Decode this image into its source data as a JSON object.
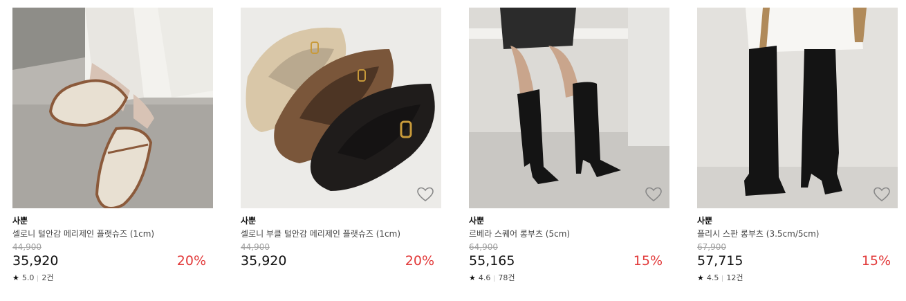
{
  "products": [
    {
      "brand": "사뿐",
      "title": "셀로니 털안감 메리제인 플랫슈즈 (1cm)",
      "original_price": "44,900",
      "price": "35,920",
      "discount": "20%",
      "rating": "5.0",
      "reviews": "2건"
    },
    {
      "brand": "사뿐",
      "title": "셀로니 부클 털안감 메리제인 플랫슈즈 (1cm)",
      "original_price": "44,900",
      "price": "35,920",
      "discount": "20%"
    },
    {
      "brand": "사뿐",
      "title": "르베라 스퀘어 롱부츠 (5cm)",
      "original_price": "64,900",
      "price": "55,165",
      "discount": "15%",
      "rating": "4.6",
      "reviews": "78건"
    },
    {
      "brand": "사뿐",
      "title": "플리시 스판 롱부츠 (3.5cm/5cm)",
      "original_price": "67,900",
      "price": "57,715",
      "discount": "15%",
      "rating": "4.5",
      "reviews": "12건"
    }
  ],
  "colors": {
    "discount": "#e23a3a",
    "strikethrough": "#a0a0a0"
  },
  "icons": {
    "wishlist": "heart-outline-icon",
    "rating": "star-icon"
  }
}
